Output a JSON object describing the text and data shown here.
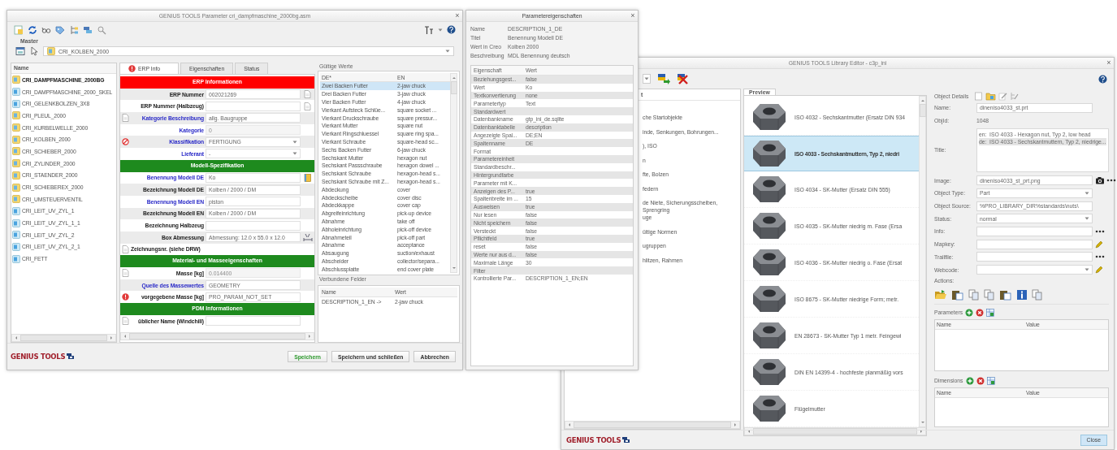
{
  "params_window": {
    "title": "GENIUS TOOLS Parameter cri_dampfmaschine_2000bg.asm",
    "close": "×",
    "master_label": "Master",
    "master_value": "CRI_KOLBEN_2000",
    "tree_header": "Name",
    "tree": [
      {
        "label": "CRI_DAMPFMASCHINE_2000BG",
        "kind": "assembly",
        "current": true
      },
      {
        "label": "CRI_DAMPFMASCHINE_2000_SKEL",
        "kind": "part",
        "current": false
      },
      {
        "label": "CRI_GELENKBOLZEN_3X8",
        "kind": "part",
        "current": false
      },
      {
        "label": "CRI_PLEUL_2000",
        "kind": "assembly",
        "current": false
      },
      {
        "label": "CRI_KURBELWELLE_2000",
        "kind": "assembly",
        "current": false
      },
      {
        "label": "CRI_KOLBEN_2000",
        "kind": "assembly",
        "current": false
      },
      {
        "label": "CRI_SCHIEBER_2000",
        "kind": "assembly",
        "current": false
      },
      {
        "label": "CRI_ZYLINDER_2000",
        "kind": "assembly",
        "current": false
      },
      {
        "label": "CRI_STAENDER_2000",
        "kind": "assembly",
        "current": false
      },
      {
        "label": "CRI_SCHIEBEREX_2000",
        "kind": "assembly",
        "current": false
      },
      {
        "label": "CRI_UMSTEUERVENTIL",
        "kind": "assembly",
        "current": false
      },
      {
        "label": "CRI_LEIT_UV_ZYL_1",
        "kind": "part",
        "current": false
      },
      {
        "label": "CRI_LEIT_UV_ZYL_1_1",
        "kind": "part",
        "current": false
      },
      {
        "label": "CRI_LEIT_UV_ZYL_2",
        "kind": "part",
        "current": false
      },
      {
        "label": "CRI_LEIT_UV_ZYL_2_1",
        "kind": "part",
        "current": false
      },
      {
        "label": "CRI_FETT",
        "kind": "part",
        "current": false
      }
    ],
    "tabs": [
      {
        "label": "ERP Info",
        "selected": true,
        "error": true
      },
      {
        "label": "Eigenschaften",
        "selected": false,
        "error": false
      },
      {
        "label": "Status",
        "selected": false,
        "error": false
      }
    ],
    "form": [
      {
        "kind": "header",
        "label": "ERP Informationen",
        "color": "#ff0000"
      },
      {
        "kind": "field",
        "label": "ERP Nummer",
        "value": "002021269",
        "link": false,
        "disabled": false,
        "action": {
          "kind": "doc"
        }
      },
      {
        "kind": "field",
        "label": "ERP Nummer (Halbzeug)",
        "link": false,
        "action": {
          "kind": "doc"
        }
      },
      {
        "kind": "field",
        "label": "Kategorie Beschreibung",
        "value": "allg. Baugruppe",
        "link": true,
        "disabled": false,
        "flag": {
          "kind": "doc"
        }
      },
      {
        "kind": "field",
        "label": "Kategorie",
        "value": "0",
        "link": true,
        "disabled": true
      },
      {
        "kind": "field",
        "label": "Klassifikation",
        "value": "FERTIGUNG",
        "link": true,
        "disabled": false,
        "flag": {
          "kind": "blocked"
        },
        "dropdown": true
      },
      {
        "kind": "field",
        "label": "Lieferant",
        "value": "-",
        "link": true,
        "disabled": false,
        "dropdown": true
      },
      {
        "kind": "header",
        "label": "Modell-Spezifikation",
        "color": "#1e8a1e"
      },
      {
        "kind": "field",
        "label": "Benennung Modell DE",
        "value": "Ko",
        "link": true,
        "disabled": false,
        "action": {
          "kind": "book"
        }
      },
      {
        "kind": "field",
        "label": "Bezeichnung Modell DE",
        "value": "Kolben / 2000 / DM",
        "link": false,
        "disabled": false
      },
      {
        "kind": "field",
        "label": "Benennung Modell EN",
        "value": "piston",
        "link": true,
        "disabled": false
      },
      {
        "kind": "field",
        "label": "Bezeichnung Modell EN",
        "value": "Kolben / 2000 / DM",
        "link": false,
        "disabled": false
      },
      {
        "kind": "field",
        "label": "Bezeichnung Halbzeug",
        "link": false
      },
      {
        "kind": "field",
        "label": "Box Abmessung",
        "value": "Abmessung: 12.0 x 55.0 x 12.0",
        "link": false,
        "disabled": false,
        "action": {
          "kind": "lbh"
        }
      },
      {
        "kind": "wide",
        "label": "Zeichnungsnr. (siehe DRW)",
        "flag": {
          "kind": "doc"
        }
      },
      {
        "kind": "header",
        "label": "Material- und Masseeigenschaften",
        "color": "#1e8a1e"
      },
      {
        "kind": "field",
        "label": "Masse [kg]",
        "value": "0.014400",
        "link": false,
        "disabled": true,
        "flag": {
          "kind": "doc"
        }
      },
      {
        "kind": "field",
        "label": "Quelle des Massewertes",
        "value": "GEOMETRY",
        "link": true,
        "disabled": false
      },
      {
        "kind": "field",
        "label": "vorgegebene Masse [kg]",
        "value": "PRO_PARAM_NOT_SET",
        "link": false,
        "disabled": false,
        "flag": {
          "kind": "error"
        }
      },
      {
        "kind": "header",
        "label": "PDM Informationen",
        "color": "#1e8a1e"
      },
      {
        "kind": "field",
        "label": "üblicher Name (Windchill)",
        "link": false,
        "flag": {
          "kind": "doc"
        }
      }
    ],
    "valid_values": {
      "title": "Gültige Werte",
      "columns": [
        "DE*",
        "EN"
      ],
      "rows": [
        {
          "de": "Zwei Backen Futter",
          "en": "2-jaw chuck",
          "selected": true
        },
        {
          "de": "Drei Backen Futter",
          "en": "3-jaw chuck",
          "selected": false
        },
        {
          "de": "Vier Backen Futter",
          "en": "4-jaw chuck",
          "selected": false
        },
        {
          "de": "Vierkant Aufsteck Schlüe...",
          "en": "square socket ...",
          "selected": false
        },
        {
          "de": "Vierkant Druckschraube",
          "en": "square pressur...",
          "selected": false
        },
        {
          "de": "Vierkant Mutter",
          "en": "square nut",
          "selected": false
        },
        {
          "de": "Vierkant Ringschluessel",
          "en": "square ring spa...",
          "selected": false
        },
        {
          "de": "Vierkant Schraube",
          "en": "square-head sc...",
          "selected": false
        },
        {
          "de": "Sechs Backen Futter",
          "en": "6-jaw chuck",
          "selected": false
        },
        {
          "de": "Sechskant Mutter",
          "en": "hexagon nut",
          "selected": false
        },
        {
          "de": "Sechskant Passschraube",
          "en": "hexagon dowel ...",
          "selected": false
        },
        {
          "de": "Sechskant Schraube",
          "en": "hexagon-head s...",
          "selected": false
        },
        {
          "de": "Sechskant Schraube mit Z...",
          "en": "hexagon-head s...",
          "selected": false
        },
        {
          "de": "Abdeckung",
          "en": "cover",
          "selected": false
        },
        {
          "de": "Abdeckscheibe",
          "en": "cover disc",
          "selected": false
        },
        {
          "de": "Abdeckkappe",
          "en": "cover cap",
          "selected": false
        },
        {
          "de": "Abgreifeinrichtung",
          "en": "pick-up device",
          "selected": false
        },
        {
          "de": "Abnahme",
          "en": "take off",
          "selected": false
        },
        {
          "de": "Abholeinrichtung",
          "en": "pick-off device",
          "selected": false
        },
        {
          "de": "Abnahmeteil",
          "en": "pick-off part",
          "selected": false
        },
        {
          "de": "Abnahme",
          "en": "acceptance",
          "selected": false
        },
        {
          "de": "Absaugung",
          "en": "suction/exhaust",
          "selected": false
        },
        {
          "de": "Abscheider",
          "en": "collector/separa...",
          "selected": false
        },
        {
          "de": "Abschlussplatte",
          "en": "end cover plate",
          "selected": false
        }
      ]
    },
    "linked_fields": {
      "title": "Verbundene Felder",
      "columns": [
        "Name",
        "Wert"
      ],
      "rows": [
        {
          "name": "DESCRIPTION_1_EN ->",
          "value": "2-jaw chuck"
        }
      ]
    },
    "logo": "GENIUS TOOLS",
    "buttons": [
      {
        "label": "Speichern",
        "kind": "primary"
      },
      {
        "label": "Speichern und schließen",
        "kind": "normal"
      },
      {
        "label": "Abbrechen",
        "kind": "normal"
      }
    ]
  },
  "properties_window": {
    "title": "Parametereigenschaften",
    "close": "×",
    "info": [
      {
        "label": "Name",
        "value": "DESCRIPTION_1_DE"
      },
      {
        "label": "Titel",
        "value": "Benennung Modell DE"
      },
      {
        "label": "Wert in Creo",
        "value": "Kolben 2000"
      },
      {
        "label": "Beschreibung",
        "value": "MDL Benennung deutsch"
      }
    ],
    "columns": [
      "Eigenschaft",
      "Wert"
    ],
    "rows": [
      {
        "property": "Beziehungsgest...",
        "value": "false"
      },
      {
        "property": "Wert",
        "value": "Ko"
      },
      {
        "property": "Textkonvertierung",
        "value": "none"
      },
      {
        "property": "Parametertyp",
        "value": "Text"
      },
      {
        "property": "Standardwert"
      },
      {
        "property": "Datenbankname",
        "value": "gtp_ini_de.sqlite"
      },
      {
        "property": "Datenbanktabelle",
        "value": "description"
      },
      {
        "property": "Angezeigte Spal...",
        "value": "DE;EN"
      },
      {
        "property": "Spaltenname",
        "value": "DE"
      },
      {
        "property": "Format"
      },
      {
        "property": "Parametereinheit"
      },
      {
        "property": "Standardbeschr..."
      },
      {
        "property": "Hintergrundfarbe"
      },
      {
        "property": "Parameter mit K..."
      },
      {
        "property": "Anzeigen des P...",
        "value": "true"
      },
      {
        "property": "Spaltenbreite im ...",
        "value": "15"
      },
      {
        "property": "Ausweisen",
        "value": "true"
      },
      {
        "property": "Nur lesen",
        "value": "false"
      },
      {
        "property": "Nicht speichern",
        "value": "false"
      },
      {
        "property": "Versteckt",
        "value": "false"
      },
      {
        "property": "Pflichtfeld",
        "value": "true"
      },
      {
        "property": "reset",
        "value": "false"
      },
      {
        "property": "Werte nur aus d...",
        "value": "false"
      },
      {
        "property": "Maximale Länge",
        "value": "30"
      },
      {
        "property": "Filter"
      },
      {
        "property": "Kontrollierte Par...",
        "value": "DESCRIPTION_1_EN;EN"
      }
    ]
  },
  "library_window": {
    "title": "GENIUS TOOLS Library Editor - c3p_ini",
    "close": "×",
    "tree_header": "t",
    "tree": [
      "che Startobjekte",
      "inde, Senkungen, Bohrungen...",
      "), ISO",
      "n",
      "fte, Bolzen",
      "federn",
      "de Niete, Sicherungsscheiben, Sprengring",
      "uge",
      "ültige Normen",
      "ugruppen",
      "hlitzen, Rahmen"
    ],
    "preview_tab": "Preview",
    "items": [
      {
        "label": "ISO 4032 - Sechskantmutter (Ersatz DIN 934",
        "selected": false
      },
      {
        "label": "ISO 4033 - Sechskantmuttern, Typ 2, niedri",
        "selected": true
      },
      {
        "label": "ISO 4034 - SK-Mutter (Ersatz DIN 555)",
        "selected": false
      },
      {
        "label": "ISO 4035 - SK-Mutter niedrig m. Fase (Ersa",
        "selected": false
      },
      {
        "label": "ISO 4036 - SK-Mutter niedrig o. Fase (Ersat",
        "selected": false
      },
      {
        "label": "ISO 8675 - SK-Mutter niedrige Form; metr.",
        "selected": false
      },
      {
        "label": "EN 28673 - SK-Mutter Typ 1 metr. Feingewi",
        "selected": false
      },
      {
        "label": "DIN EN 14399-4 - hochfeste planmäßig vors",
        "selected": false
      },
      {
        "label": "Flügelmutter",
        "selected": false
      }
    ],
    "details_title": "Object Details",
    "fields": [
      {
        "label": "Name:",
        "kind": "input",
        "value": "dineniso4033_st.prt"
      },
      {
        "label": "ObjId:",
        "kind": "text",
        "value": "1048"
      },
      {
        "label": "Title:",
        "kind": "list",
        "entries": [
          {
            "lang": "en:",
            "text": "ISO 4033 - Hexagon nut, Typ 2, low head",
            "selected": false
          },
          {
            "lang": "de:",
            "text": "ISO 4033 - Sechskantmuttern, Typ 2, niedrige...",
            "selected": true
          }
        ]
      },
      {
        "label": "Image:",
        "kind": "input",
        "value": "dineniso4033_st_prt.png",
        "tools": [
          {
            "kind": "camera"
          },
          {
            "kind": "dots"
          }
        ]
      },
      {
        "label": "Object Type:",
        "kind": "select",
        "value": "Part"
      },
      {
        "label": "Object Source:",
        "kind": "input",
        "value": "%PRO_LIBRARY_DIR%standards\\nuts\\"
      },
      {
        "label": "Status:",
        "kind": "select",
        "value": "normal"
      },
      {
        "label": "Info:",
        "kind": "input",
        "tools": [
          {
            "kind": "dots"
          }
        ]
      },
      {
        "label": "Mapkey:",
        "kind": "input",
        "tools": [
          {
            "kind": "pencil"
          }
        ]
      },
      {
        "label": "Trailfile:",
        "kind": "input",
        "tools": [
          {
            "kind": "dots"
          }
        ]
      },
      {
        "label": "Webcode:",
        "kind": "select",
        "tools": [
          {
            "kind": "pencil"
          }
        ]
      }
    ],
    "actions_label": "Actions:",
    "parameters": {
      "label": "Parameters",
      "columns": [
        "Name",
        "Value"
      ]
    },
    "dimensions": {
      "label": "Dimensions",
      "columns": [
        "Name",
        "Value"
      ]
    },
    "close_button": "Close",
    "logo": "GENIUS TOOLS"
  }
}
